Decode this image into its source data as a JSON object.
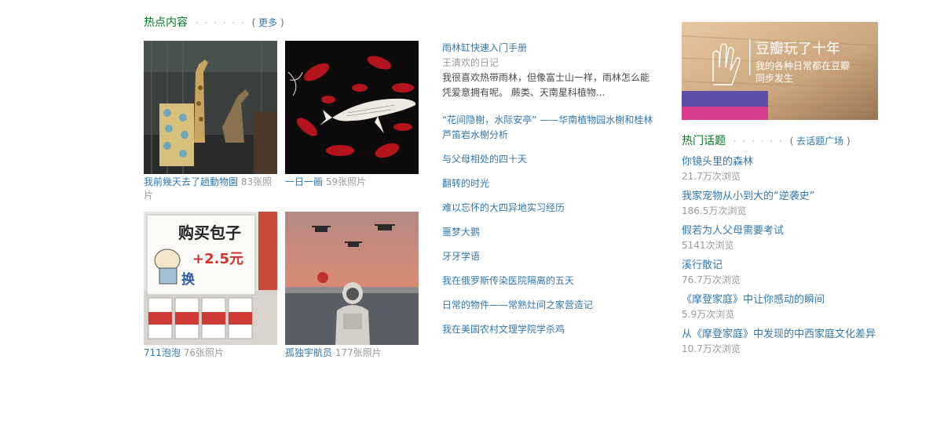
{
  "hot": {
    "title": "热点内容",
    "dots": "· · · · · ·",
    "paren_open": "(",
    "more_label": "更多",
    "paren_close": ")",
    "albums": [
      {
        "title": "我前幾天去了趟動物園",
        "count": "83张照片"
      },
      {
        "title": "一日一画",
        "count": "59张照片"
      },
      {
        "title": "711泡泡",
        "count": "76张照片"
      },
      {
        "title": "孤独宇航员",
        "count": "177张照片"
      }
    ],
    "album_image_texts": {
      "bun_sign_line1": "购买包子",
      "bun_sign_price": "+2.5元",
      "bun_sign_swap": "换"
    },
    "notes": {
      "featured_title": "雨林缸快速入门手册",
      "featured_sub": "王清欢的日记",
      "featured_abstract": "我很喜欢热带雨林，但像富士山一样，雨林怎么能凭爱意拥有呢。 蕨类、天南星科植物...",
      "items": [
        "“花间隐榭，水际安亭” ——华南植物园水榭和桂林芦笛岩水榭分析",
        "与父母相处的四十天",
        "翻转的时光",
        "难以忘怀的大四异地实习经历",
        "噩梦大鹅",
        "牙牙学语",
        "我在俄罗斯传染医院隔离的五天",
        "日常的物件——常熟灶间之家营造记",
        "我在美国农村文理学院学杀鸡"
      ]
    }
  },
  "banner": {
    "line1": "豆瓣玩了十年",
    "line2": "我的各种日常都在豆瓣",
    "line3": "同步发生"
  },
  "topics": {
    "title": "热门话题",
    "dots": "· · · · · ·",
    "paren_open": "(",
    "link_label": "去话题广场",
    "paren_close": ")",
    "items": [
      {
        "title": "你镜头里的森林",
        "views": "21.7万次浏览"
      },
      {
        "title": "我家宠物从小到大的“逆袭史”",
        "views": "186.5万次浏览"
      },
      {
        "title": "假若为人父母需要考试",
        "views": "5141次浏览"
      },
      {
        "title": "溪行散记",
        "views": "76.7万次浏览"
      },
      {
        "title": "《摩登家庭》中让你感动的瞬间",
        "views": "5.9万次浏览"
      },
      {
        "title": "从《摩登家庭》中发现的中西家庭文化差异",
        "views": "10.7万次浏览"
      }
    ]
  },
  "colors": {
    "link": "#3377aa",
    "section_title": "#007722",
    "muted": "#999999",
    "text": "#494949"
  }
}
